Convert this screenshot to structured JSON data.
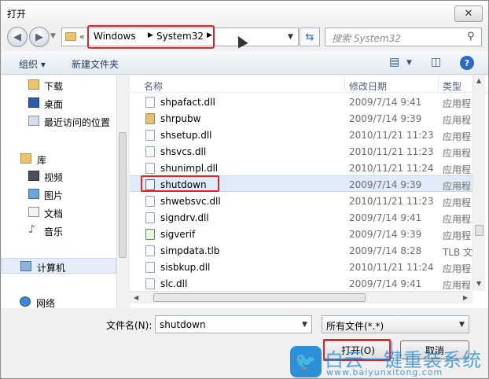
{
  "window": {
    "title": "打开",
    "close_glyph": "✕"
  },
  "address": {
    "crumbs": [
      "Windows",
      "System32"
    ],
    "search_placeholder": "搜索 System32"
  },
  "toolbar": {
    "organize_label": "组织 ▾",
    "new_folder_label": "新建文件夹"
  },
  "nav": {
    "items": [
      {
        "label": "下载",
        "icon": "download-folder-icon"
      },
      {
        "label": "桌面",
        "icon": "desktop-icon"
      },
      {
        "label": "最近访问的位置",
        "icon": "recent-places-icon"
      },
      {
        "label": "库",
        "icon": "library-icon"
      },
      {
        "label": "视频",
        "icon": "video-library-icon"
      },
      {
        "label": "图片",
        "icon": "picture-library-icon"
      },
      {
        "label": "文档",
        "icon": "document-library-icon"
      },
      {
        "label": "音乐",
        "icon": "music-library-icon"
      },
      {
        "label": "计算机",
        "icon": "computer-icon"
      },
      {
        "label": "网络",
        "icon": "network-icon"
      }
    ]
  },
  "columns": {
    "name": "名称",
    "date": "修改日期",
    "type": "类型"
  },
  "files": [
    {
      "name": "shpafact.dll",
      "date": "2009/7/14 9:41",
      "type": "应用程"
    },
    {
      "name": "shrpubw",
      "date": "2009/7/14 9:39",
      "type": "应用程"
    },
    {
      "name": "shsetup.dll",
      "date": "2010/11/21 11:23",
      "type": "应用程"
    },
    {
      "name": "shsvcs.dll",
      "date": "2010/11/21 11:23",
      "type": "应用程"
    },
    {
      "name": "shunimpl.dll",
      "date": "2010/11/21 11:24",
      "type": "应用程"
    },
    {
      "name": "shutdown",
      "date": "2009/7/14 9:39",
      "type": "应用程"
    },
    {
      "name": "shwebsvc.dll",
      "date": "2010/11/21 11:23",
      "type": "应用程"
    },
    {
      "name": "signdrv.dll",
      "date": "2009/7/14 9:41",
      "type": "应用程"
    },
    {
      "name": "sigverif",
      "date": "2009/7/14 9:39",
      "type": "应用程"
    },
    {
      "name": "simpdata.tlb",
      "date": "2009/7/14 8:28",
      "type": "TLB 文"
    },
    {
      "name": "sisbkup.dll",
      "date": "2010/11/21 11:24",
      "type": "应用程"
    },
    {
      "name": "slc.dll",
      "date": "2009/7/14 9:41",
      "type": "应用程"
    }
  ],
  "selected_file": "shutdown",
  "bottom": {
    "filename_label": "文件名(N):",
    "filename_value": "shutdown",
    "filter_value": "所有文件(*.*)",
    "open_label": "打开(O)",
    "cancel_label": "取消"
  },
  "watermark": {
    "text": "白云一键重装系统",
    "url": "www.baiyunxitong.com"
  },
  "colors": {
    "highlight": "#e0242a",
    "selection": "#dfebf8",
    "accent": "#1e88d8"
  }
}
